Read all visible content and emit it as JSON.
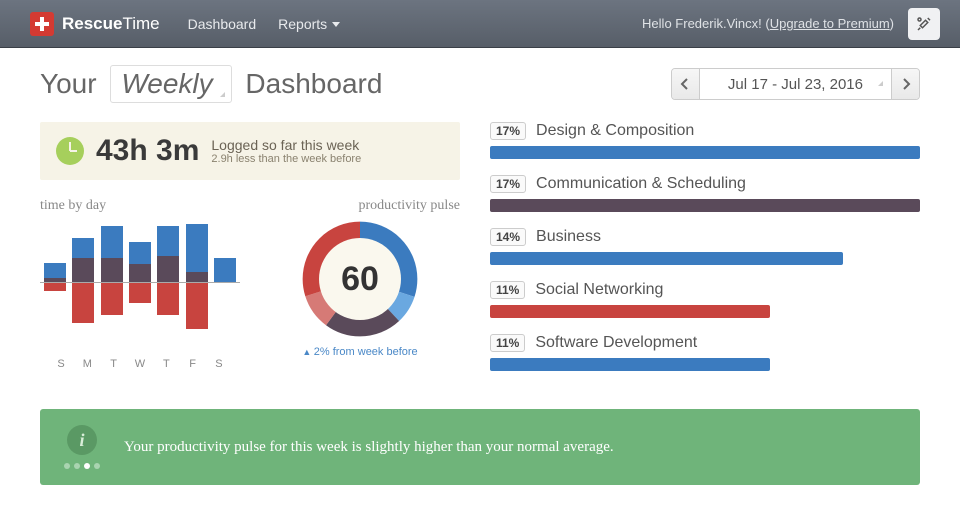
{
  "header": {
    "brand_a": "Rescue",
    "brand_b": "Time",
    "nav_dashboard": "Dashboard",
    "nav_reports": "Reports",
    "greeting_prefix": "Hello ",
    "greeting_name": "Frederik.Vincx",
    "greeting_sep": "! (",
    "upgrade_link": "Upgrade to Premium",
    "greeting_suffix": ")"
  },
  "subheader": {
    "prefix": "Your ",
    "period": "Weekly",
    "suffix": " Dashboard",
    "date_range": "Jul 17 - Jul 23, 2016"
  },
  "logged": {
    "hours": "43h 3m",
    "line1": "Logged so far this week",
    "line2": "2.9h less than the week before"
  },
  "charts": {
    "time_by_day_title": "time by day",
    "pulse_title": "productivity pulse",
    "pulse_value": "60",
    "pulse_delta": "2% from week before",
    "days": [
      "S",
      "M",
      "T",
      "W",
      "T",
      "F",
      "S"
    ]
  },
  "chart_data": [
    {
      "type": "bar",
      "title": "time by day",
      "categories": [
        "S",
        "M",
        "T",
        "W",
        "T",
        "F",
        "S"
      ],
      "series": [
        {
          "name": "productive_top_blue",
          "values": [
            15,
            20,
            32,
            22,
            30,
            48,
            24
          ]
        },
        {
          "name": "neutral_mid_dark",
          "values": [
            4,
            24,
            24,
            18,
            26,
            10,
            0
          ]
        },
        {
          "name": "distracting_bottom_red",
          "values": [
            8,
            40,
            32,
            20,
            32,
            46,
            0
          ]
        }
      ],
      "axis_note": "values are relative pixel heights; positive stack (blue+dark) above axis, red below"
    },
    {
      "type": "pie",
      "title": "productivity pulse",
      "center_value": 60,
      "series": [
        {
          "name": "very_productive",
          "color": "#3b7bbf",
          "value": 30
        },
        {
          "name": "productive",
          "color": "#6aa8e0",
          "value": 8
        },
        {
          "name": "neutral",
          "color": "#5a4a5a",
          "value": 22
        },
        {
          "name": "distracting",
          "color": "#d67a76",
          "value": 10
        },
        {
          "name": "very_distracting",
          "color": "#c8443f",
          "value": 30
        }
      ]
    },
    {
      "type": "bar",
      "title": "top categories",
      "categories": [
        "Design & Composition",
        "Communication & Scheduling",
        "Business",
        "Social Networking",
        "Software Development"
      ],
      "values": [
        17,
        17,
        14,
        11,
        11
      ],
      "colors": [
        "#3b7bbf",
        "#5a4a5a",
        "#3b7bbf",
        "#c8443f",
        "#3b7bbf"
      ]
    }
  ],
  "categories": [
    {
      "pct": "17%",
      "label": "Design & Composition",
      "width": 100,
      "color": "#3b7bbf"
    },
    {
      "pct": "17%",
      "label": "Communication & Scheduling",
      "width": 100,
      "color": "#5a4a5a"
    },
    {
      "pct": "14%",
      "label": "Business",
      "width": 82,
      "color": "#3b7bbf"
    },
    {
      "pct": "11%",
      "label": "Social Networking",
      "width": 65,
      "color": "#c8443f"
    },
    {
      "pct": "11%",
      "label": "Software Development",
      "width": 65,
      "color": "#3b7bbf"
    }
  ],
  "insight": {
    "text": "Your productivity pulse for this week is slightly higher than your normal average."
  }
}
